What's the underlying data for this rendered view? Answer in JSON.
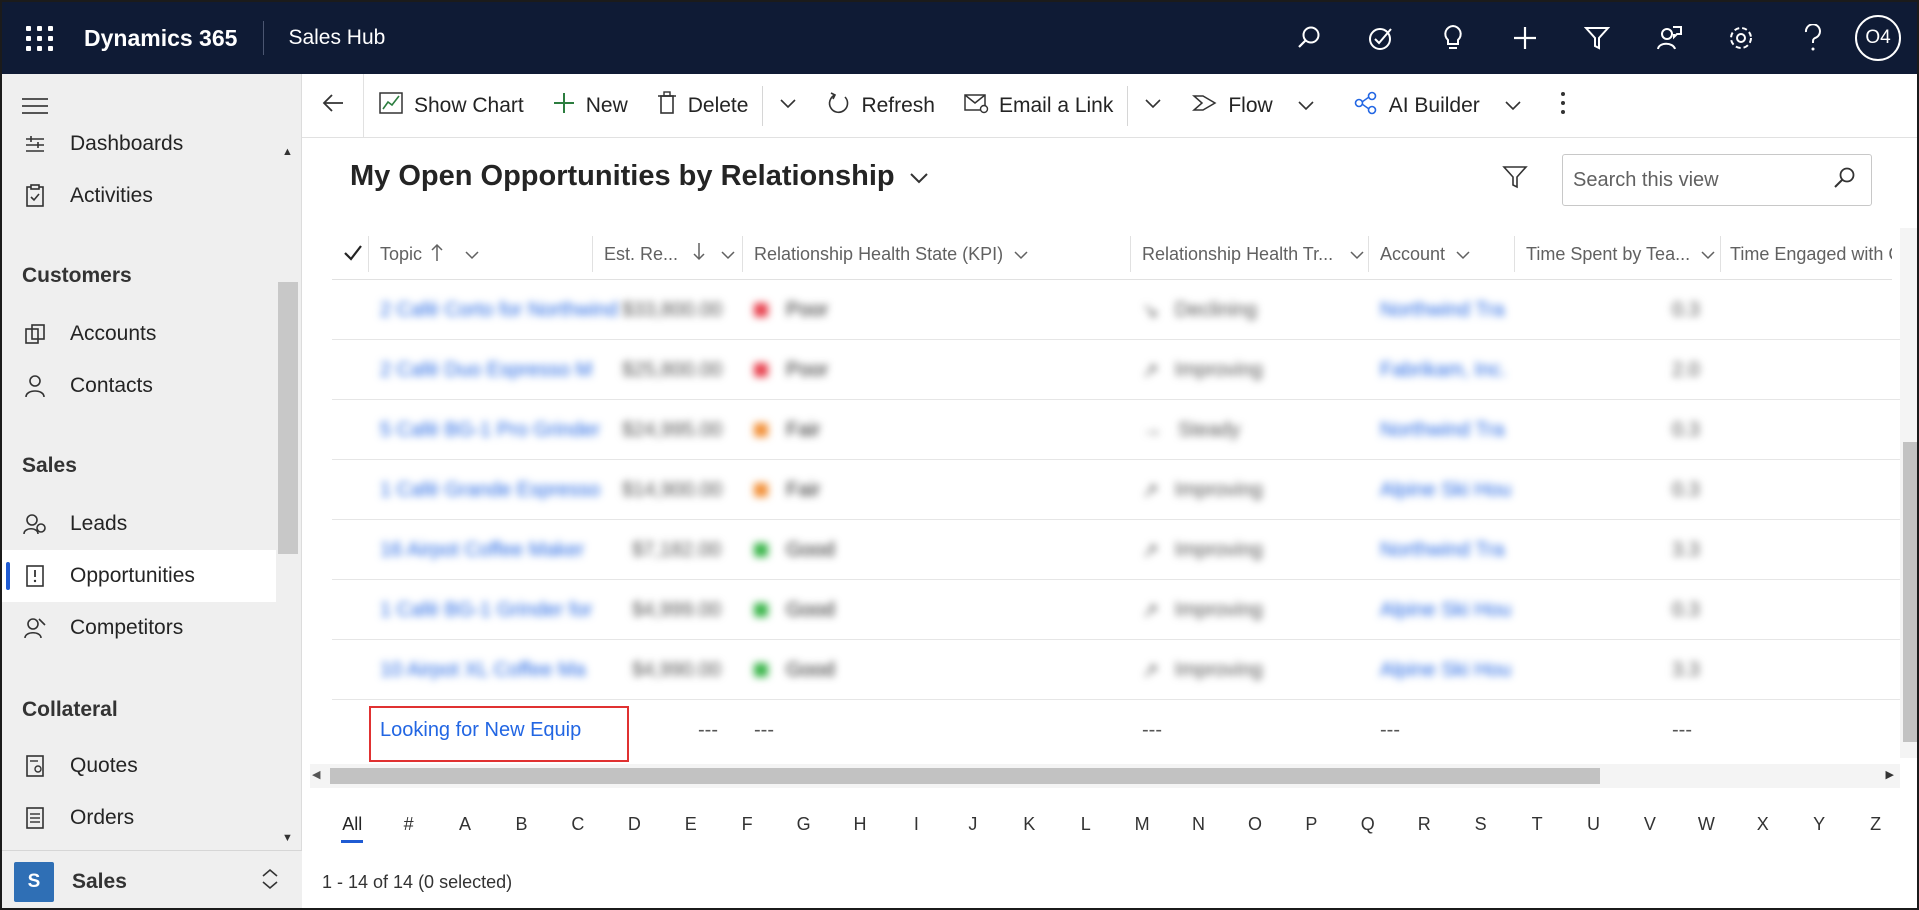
{
  "topbar": {
    "app_name": "Dynamics 365",
    "hub_name": "Sales Hub",
    "avatar_initials": "O4",
    "icons": [
      "search-icon",
      "task-icon",
      "lightbulb-icon",
      "plus-icon",
      "filter-icon",
      "assistant-icon",
      "gear-icon",
      "help-icon"
    ],
    "bg_color": "#0f1b35"
  },
  "sidebar": {
    "items_top": [
      {
        "label": "Dashboards",
        "icon": "dashboard-icon"
      },
      {
        "label": "Activities",
        "icon": "clipboard-icon"
      }
    ],
    "groups": [
      {
        "title": "Customers",
        "items": [
          {
            "label": "Accounts",
            "icon": "accounts-icon"
          },
          {
            "label": "Contacts",
            "icon": "person-icon"
          }
        ]
      },
      {
        "title": "Sales",
        "items": [
          {
            "label": "Leads",
            "icon": "leads-icon"
          },
          {
            "label": "Opportunities",
            "icon": "opportunity-icon"
          },
          {
            "label": "Competitors",
            "icon": "competitor-icon"
          }
        ]
      },
      {
        "title": "Collateral",
        "items": [
          {
            "label": "Quotes",
            "icon": "quote-icon"
          },
          {
            "label": "Orders",
            "icon": "order-icon"
          }
        ]
      }
    ],
    "active_item": "Opportunities",
    "area": {
      "badge": "S",
      "label": "Sales"
    }
  },
  "commandbar": {
    "show_chart": "Show Chart",
    "new": "New",
    "delete": "Delete",
    "refresh": "Refresh",
    "email_link": "Email a Link",
    "flow": "Flow",
    "ai_builder": "AI Builder"
  },
  "view": {
    "title": "My Open Opportunities by Relationship",
    "search_placeholder": "Search this view"
  },
  "grid": {
    "columns": [
      "Topic",
      "Est. Re...",
      "Relationship Health State (KPI)",
      "Relationship Health Tr...",
      "Account",
      "Time Spent by Tea...",
      "Time Engaged with C"
    ],
    "rows": [
      {
        "topic": "2 Café Corto for Northwind",
        "revenue": "$33,800.00",
        "state": "Poor",
        "state_color": "#e8424f",
        "trend": "Declining",
        "account": "Northwind Tra",
        "time": "0.3"
      },
      {
        "topic": "2 Café Duo Espresso M",
        "revenue": "$25,800.00",
        "state": "Poor",
        "state_color": "#e8424f",
        "trend": "Improving",
        "account": "Fabrikam, Inc.",
        "time": "2.0"
      },
      {
        "topic": "5 Café BG-1 Pro Grinder",
        "revenue": "$24,995.00",
        "state": "Fair",
        "state_color": "#f2913a",
        "trend": "Steady",
        "account": "Northwind Tra",
        "time": "0.3"
      },
      {
        "topic": "1 Café Grande Espresso",
        "revenue": "$14,900.00",
        "state": "Fair",
        "state_color": "#f2913a",
        "trend": "Improving",
        "account": "Alpine Ski Hou",
        "time": "0.3"
      },
      {
        "topic": "16 Airpot Coffee Maker",
        "revenue": "$7,182.00",
        "state": "Good",
        "state_color": "#3ab54a",
        "trend": "Improving",
        "account": "Northwind Tra",
        "time": "3.3"
      },
      {
        "topic": "1 Café BG-1 Grinder for",
        "revenue": "$4,999.00",
        "state": "Good",
        "state_color": "#3ab54a",
        "trend": "Improving",
        "account": "Alpine Ski Hou",
        "time": "0.3"
      },
      {
        "topic": "10 Airpot XL Coffee Ma",
        "revenue": "$4,990.00",
        "state": "Good",
        "state_color": "#3ab54a",
        "trend": "Improving",
        "account": "Alpine Ski Hou",
        "time": "3.3"
      }
    ],
    "last_row": {
      "topic": "Looking for New Equip",
      "revenue": "---",
      "state": "---",
      "trend": "---",
      "account": "---",
      "time": "---"
    }
  },
  "alphabet": [
    "All",
    "#",
    "A",
    "B",
    "C",
    "D",
    "E",
    "F",
    "G",
    "H",
    "I",
    "J",
    "K",
    "L",
    "M",
    "N",
    "O",
    "P",
    "Q",
    "R",
    "S",
    "T",
    "U",
    "V",
    "W",
    "X",
    "Y",
    "Z"
  ],
  "footer": {
    "status": "1 - 14 of 14 (0 selected)"
  }
}
